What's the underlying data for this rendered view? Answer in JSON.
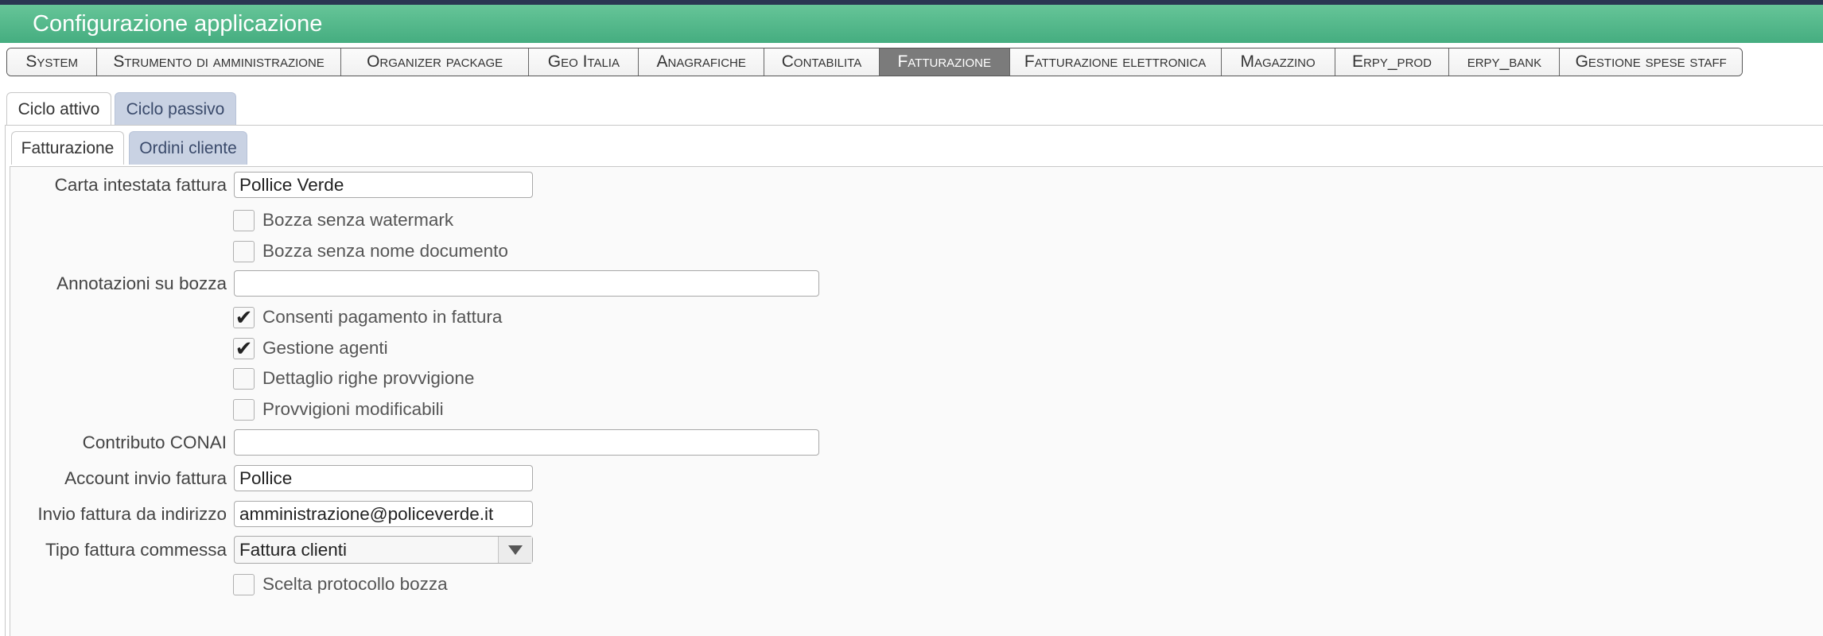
{
  "window": {
    "title": "Configurazione applicazione"
  },
  "main_tabs": [
    {
      "label": "System"
    },
    {
      "label": "Strumento di amministrazione"
    },
    {
      "label": "Organizer package"
    },
    {
      "label": "Geo Italia"
    },
    {
      "label": "Anagrafiche"
    },
    {
      "label": "Contabilita"
    },
    {
      "label": "Fatturazione",
      "active": true
    },
    {
      "label": "Fatturazione elettronica"
    },
    {
      "label": "Magazzino"
    },
    {
      "label": "Erpy_prod"
    },
    {
      "label": "erpy_bank"
    },
    {
      "label": "Gestione spese staff"
    }
  ],
  "cycle_tabs": [
    {
      "label": "Ciclo attivo",
      "selected": true
    },
    {
      "label": "Ciclo passivo",
      "selected": false
    }
  ],
  "section_tabs": [
    {
      "label": "Fatturazione",
      "selected": true
    },
    {
      "label": "Ordini cliente",
      "selected": false
    }
  ],
  "form": {
    "carta_intestata": {
      "label": "Carta intestata fattura",
      "value": "Pollice Verde"
    },
    "bozza_watermark": {
      "label": "Bozza senza watermark",
      "checked": false
    },
    "bozza_nome_doc": {
      "label": "Bozza senza nome documento",
      "checked": false
    },
    "annotazioni": {
      "label": "Annotazioni su bozza",
      "value": ""
    },
    "consenti_pagamento": {
      "label": "Consenti pagamento in fattura",
      "checked": true
    },
    "gestione_agenti": {
      "label": "Gestione agenti",
      "checked": true
    },
    "dettaglio_righe": {
      "label": "Dettaglio righe provvigione",
      "checked": false
    },
    "provvigioni_mod": {
      "label": "Provvigioni modificabili",
      "checked": false
    },
    "contributo_conai": {
      "label": "Contributo CONAI",
      "value": ""
    },
    "account_invio": {
      "label": "Account invio fattura",
      "value": "Pollice"
    },
    "invio_indirizzo": {
      "label": "Invio fattura da indirizzo",
      "value": "amministrazione@policeverde.it"
    },
    "tipo_fattura": {
      "label": "Tipo fattura commessa",
      "value": "Fattura clienti"
    },
    "scelta_protocollo": {
      "label": "Scelta protocollo bozza",
      "checked": false
    }
  },
  "icons": {
    "checkmark": "check-icon",
    "dropdown": "triangle-down-icon"
  },
  "colors": {
    "title_bar": "#45ad80",
    "active_tab": "#7b7b7b",
    "unselected_tab": "#c9d2e3"
  }
}
